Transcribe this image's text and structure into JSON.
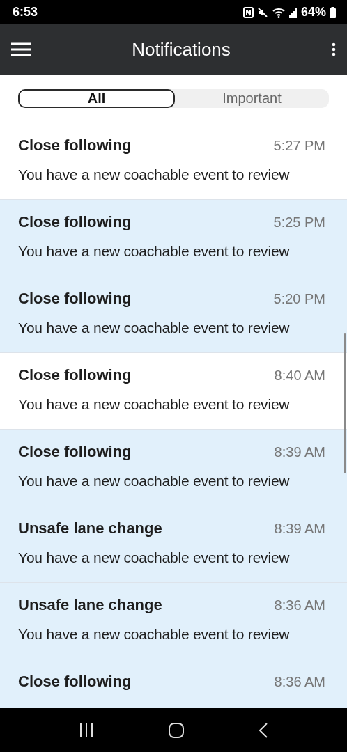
{
  "status_bar": {
    "time": "6:53",
    "battery": "64%"
  },
  "app_bar": {
    "title": "Notifications"
  },
  "tabs": [
    {
      "label": "All",
      "selected": true
    },
    {
      "label": "Important",
      "selected": false
    }
  ],
  "notifications": [
    {
      "title": "Close following",
      "time": "5:27 PM",
      "message": "You have a new coachable event to review",
      "unread": false
    },
    {
      "title": "Close following",
      "time": "5:25 PM",
      "message": "You have a new coachable event to review",
      "unread": true
    },
    {
      "title": "Close following",
      "time": "5:20 PM",
      "message": "You have a new coachable event to review",
      "unread": true
    },
    {
      "title": "Close following",
      "time": "8:40 AM",
      "message": "You have a new coachable event to review",
      "unread": false
    },
    {
      "title": "Close following",
      "time": "8:39 AM",
      "message": "You have a new coachable event to review",
      "unread": true
    },
    {
      "title": "Unsafe lane change",
      "time": "8:39 AM",
      "message": "You have a new coachable event to review",
      "unread": true
    },
    {
      "title": "Unsafe lane change",
      "time": "8:36 AM",
      "message": "You have a new coachable event to review",
      "unread": true
    },
    {
      "title": "Close following",
      "time": "8:36 AM",
      "unread": true
    }
  ]
}
